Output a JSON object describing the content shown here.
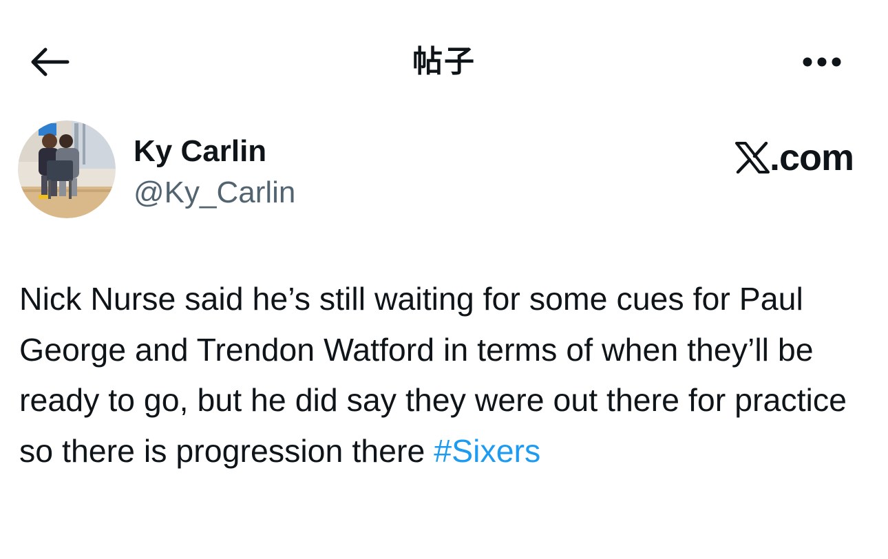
{
  "header": {
    "title": "帖子",
    "back_icon": "arrow-left-icon",
    "more_icon": "more-horizontal-icon"
  },
  "author": {
    "display_name": "Ky Carlin",
    "handle": "@Ky_Carlin",
    "avatar_icon": "profile-photo"
  },
  "brand": {
    "logo_icon": "x-logo-icon",
    "suffix": ".com"
  },
  "tweet": {
    "text": "Nick Nurse said he’s still waiting for some cues for Paul George and Trendon Watford in terms of when they’ll be ready to go, but he did say they were out there for practice so there is progression there ",
    "hashtag": "#Sixers"
  },
  "colors": {
    "text": "#0f1419",
    "secondary": "#536471",
    "link": "#1d9bf0",
    "background": "#ffffff"
  }
}
